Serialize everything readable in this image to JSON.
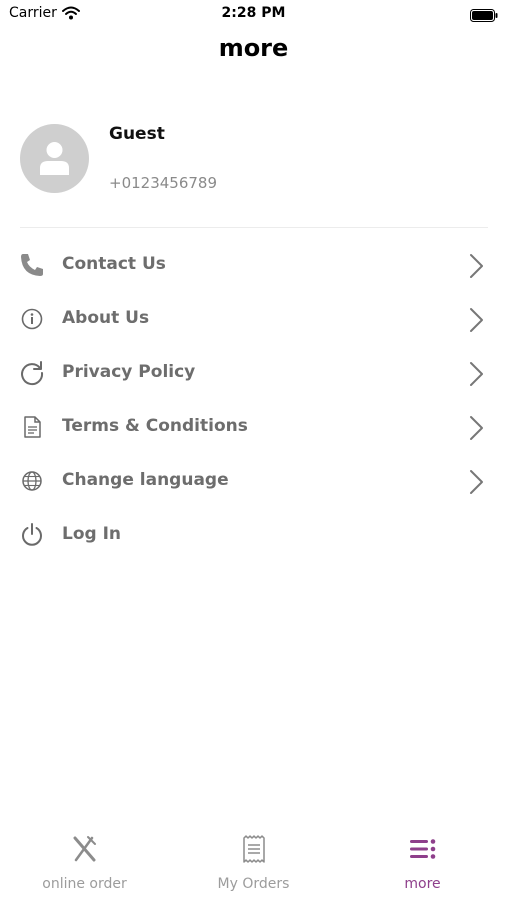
{
  "status_bar": {
    "carrier": "Carrier",
    "time": "2:28 PM"
  },
  "header": {
    "title": "more"
  },
  "profile": {
    "name": "Guest",
    "phone": "+0123456789"
  },
  "menu": {
    "items": [
      {
        "label": "Contact Us",
        "icon": "phone-icon",
        "has_chevron": true
      },
      {
        "label": "About Us",
        "icon": "info-icon",
        "has_chevron": true
      },
      {
        "label": "Privacy Policy",
        "icon": "refresh-icon",
        "has_chevron": true
      },
      {
        "label": "Terms & Conditions",
        "icon": "document-icon",
        "has_chevron": true
      },
      {
        "label": "Change language",
        "icon": "globe-icon",
        "has_chevron": true
      },
      {
        "label": "Log In",
        "icon": "power-icon",
        "has_chevron": false
      }
    ]
  },
  "tab_bar": {
    "tabs": [
      {
        "label": "online order",
        "icon": "fork-knife-icon",
        "active": false
      },
      {
        "label": "My Orders",
        "icon": "receipt-icon",
        "active": false
      },
      {
        "label": "more",
        "icon": "menu-list-icon",
        "active": true
      }
    ]
  },
  "colors": {
    "accent": "#8e3f8b",
    "text_muted": "#6d6d6d",
    "inactive_tab": "#9c9c9c",
    "avatar_bg": "#cfcfcf"
  }
}
